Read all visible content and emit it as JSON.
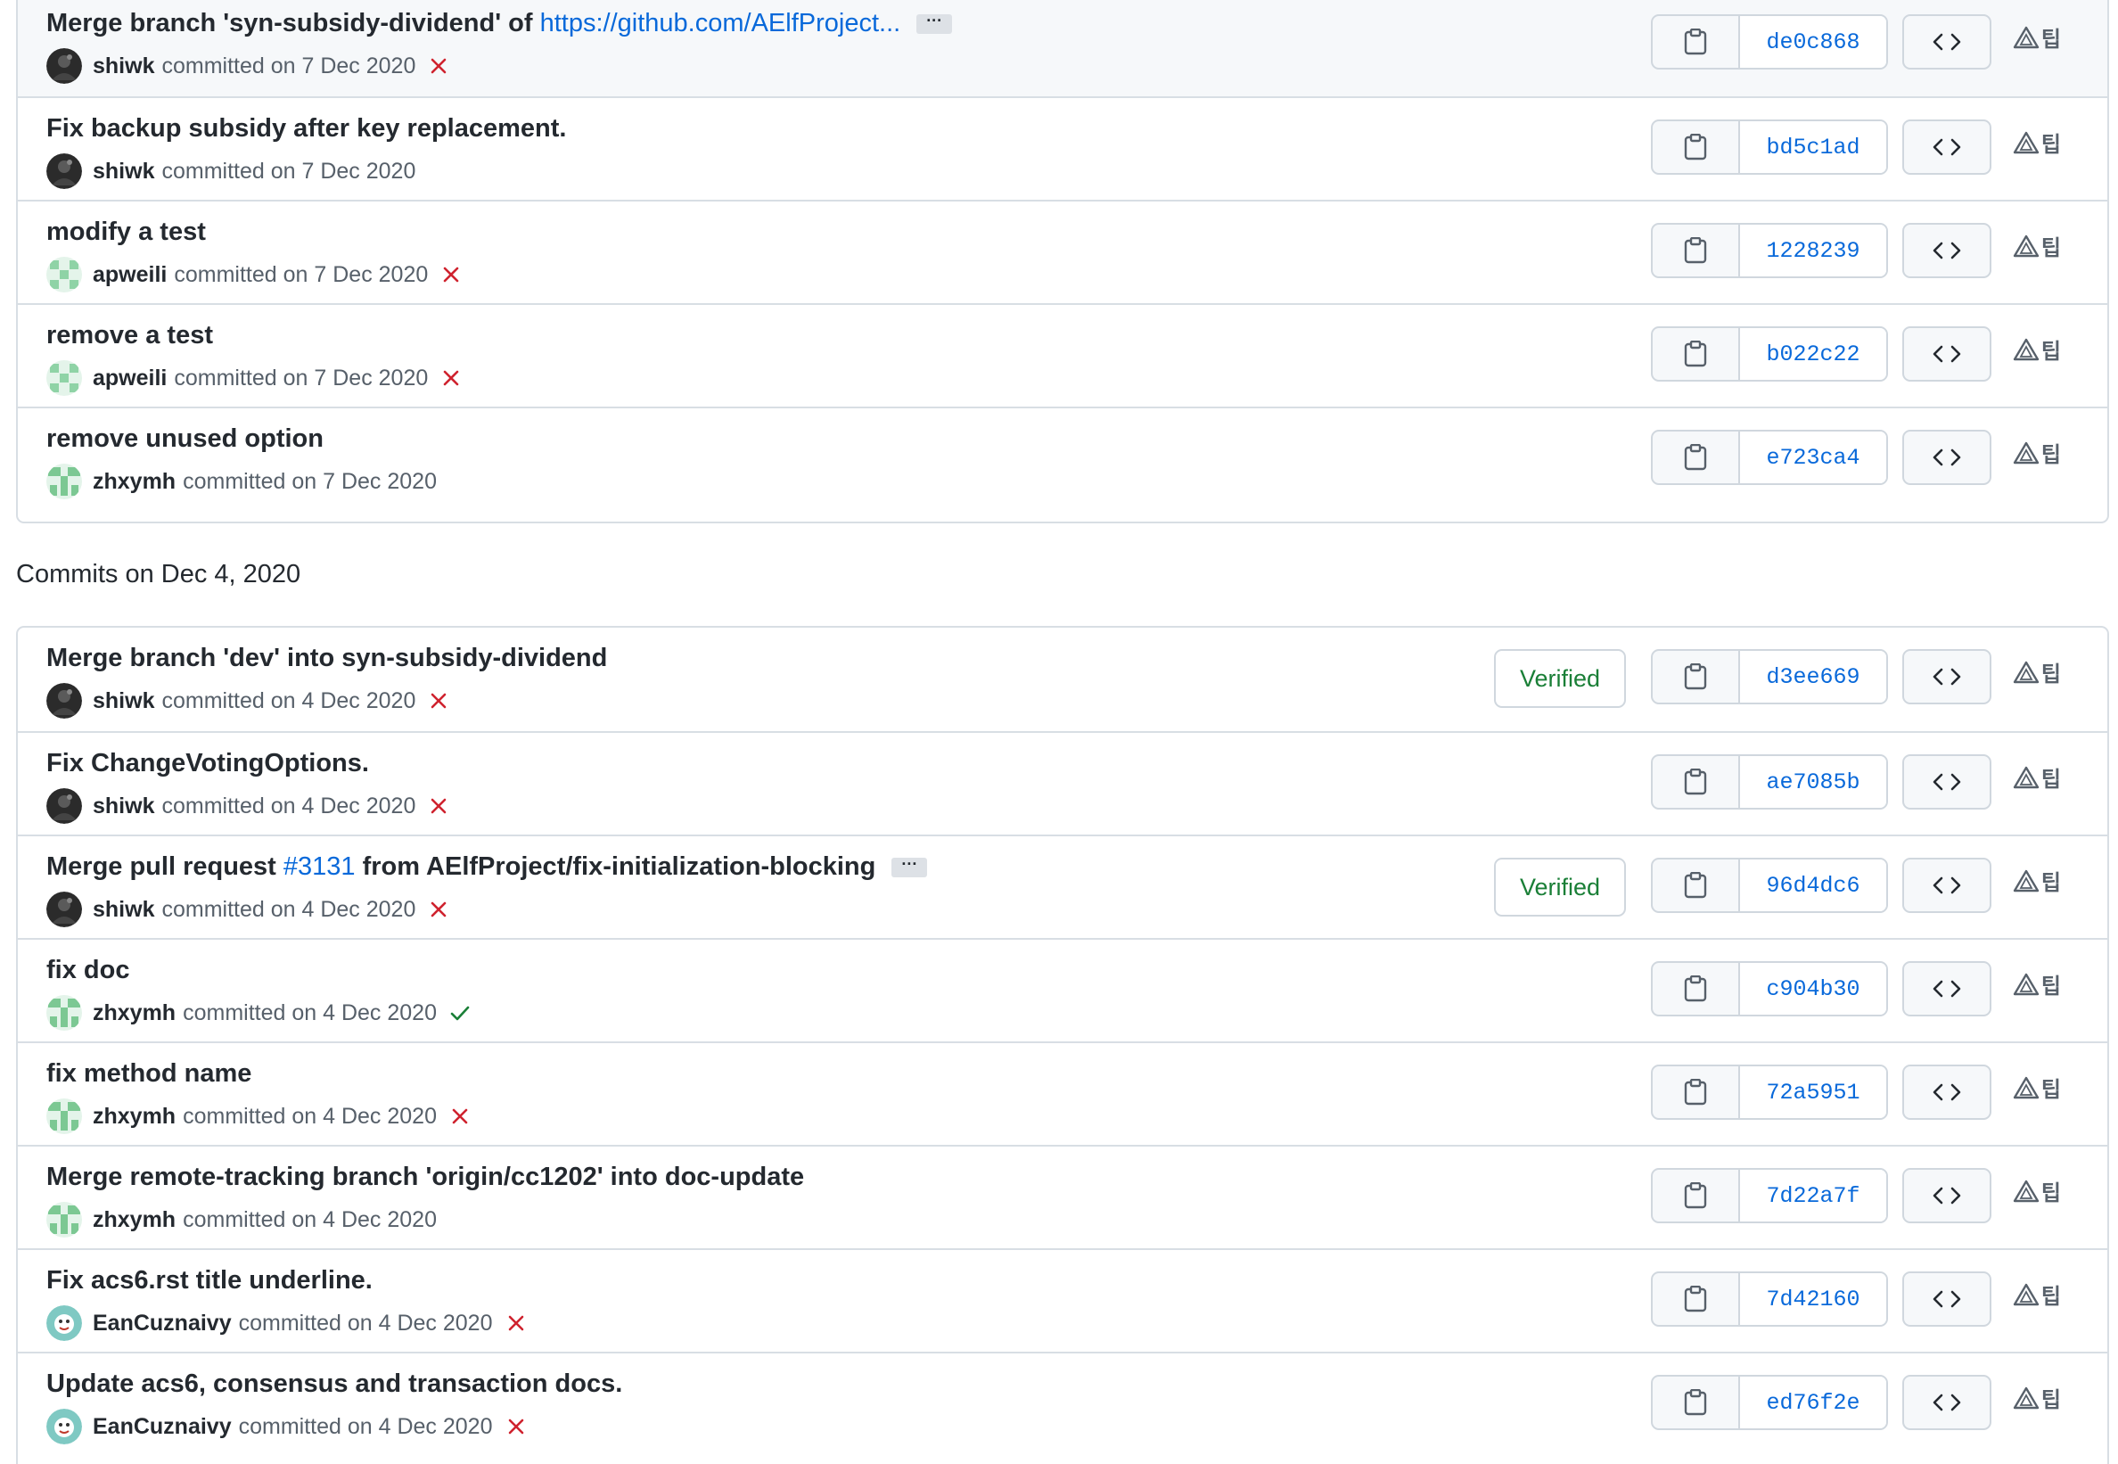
{
  "section_header": "Commits on Dec 4, 2020",
  "colors": {
    "sha": "#0969da",
    "verified": "#1a7f37",
    "fail": "#cf222e",
    "success": "#1a7f37"
  },
  "groups": [
    {
      "commits": [
        {
          "title": "Merge branch 'syn-subsidy-dividend' of",
          "link": "https://github.com/AElfProject...",
          "has_ellipsis": true,
          "author": "shiwk",
          "committed": "committed on 7 Dec 2020",
          "status": "fail",
          "sha": "de0c868",
          "avatar": "dark",
          "highlight": true
        },
        {
          "title": "Fix backup subsidy after key replacement.",
          "author": "shiwk",
          "committed": "committed on 7 Dec 2020",
          "status": "none",
          "sha": "bd5c1ad",
          "avatar": "dark"
        },
        {
          "title": "modify a test",
          "author": "apweili",
          "committed": "committed on 7 Dec 2020",
          "status": "fail",
          "sha": "1228239",
          "avatar": "green-a"
        },
        {
          "title": "remove a test",
          "author": "apweili",
          "committed": "committed on 7 Dec 2020",
          "status": "fail",
          "sha": "b022c22",
          "avatar": "green-a"
        },
        {
          "title": "remove unused option",
          "author": "zhxymh",
          "committed": "committed on 7 Dec 2020",
          "status": "none",
          "sha": "e723ca4",
          "avatar": "green-z"
        }
      ]
    },
    {
      "commits": [
        {
          "title": "Merge branch 'dev' into syn-subsidy-dividend",
          "author": "shiwk",
          "committed": "committed on 4 Dec 2020",
          "status": "fail",
          "sha": "d3ee669",
          "avatar": "dark",
          "verified": "Verified"
        },
        {
          "title": "Fix ChangeVotingOptions.",
          "author": "shiwk",
          "committed": "committed on 4 Dec 2020",
          "status": "fail",
          "sha": "ae7085b",
          "avatar": "dark"
        },
        {
          "title": "Merge pull request",
          "pr": "#3131",
          "title_suffix": "from AElfProject/fix-initialization-blocking",
          "has_ellipsis": true,
          "author": "shiwk",
          "committed": "committed on 4 Dec 2020",
          "status": "fail",
          "sha": "96d4dc6",
          "avatar": "dark",
          "verified": "Verified"
        },
        {
          "title": "fix doc",
          "author": "zhxymh",
          "committed": "committed on 4 Dec 2020",
          "status": "success",
          "sha": "c904b30",
          "avatar": "green-z"
        },
        {
          "title": "fix method name",
          "author": "zhxymh",
          "committed": "committed on 4 Dec 2020",
          "status": "fail",
          "sha": "72a5951",
          "avatar": "green-z"
        },
        {
          "title": "Merge remote-tracking branch 'origin/cc1202' into doc-update",
          "author": "zhxymh",
          "committed": "committed on 4 Dec 2020",
          "status": "none",
          "sha": "7d22a7f",
          "avatar": "green-z"
        },
        {
          "title": "Fix acs6.rst title underline.",
          "author": "EanCuznaivy",
          "committed": "committed on 4 Dec 2020",
          "status": "fail",
          "sha": "7d42160",
          "avatar": "cartoon"
        },
        {
          "title": "Update acs6, consensus and transaction docs.",
          "author": "EanCuznaivy",
          "committed": "committed on 4 Dec 2020",
          "status": "fail",
          "sha": "ed76f2e",
          "avatar": "cartoon"
        }
      ]
    }
  ],
  "icons": {
    "copy": "clipboard-icon",
    "browse": "code-icon",
    "ext": "triangle-icon",
    "ellipsis": "kebab-horizontal-icon"
  },
  "ext_glyph": "팁",
  "ellipsis_text": "···"
}
